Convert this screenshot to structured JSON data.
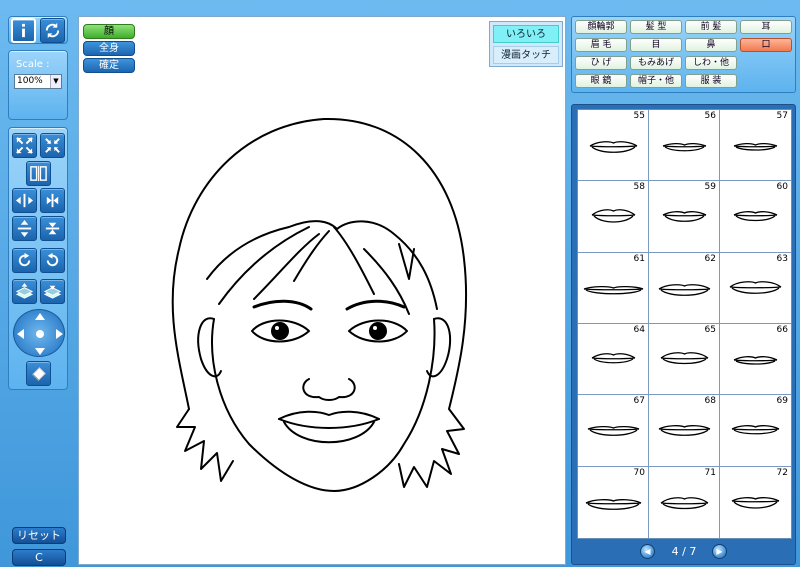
{
  "left_panel": {
    "scale_label": "Scale :",
    "scale_value": "100%",
    "reset_label": "リセット",
    "clear_label": "C"
  },
  "canvas": {
    "mode_buttons": [
      "顔",
      "全身",
      "確定"
    ],
    "active_mode": "顔",
    "style_buttons": [
      "いろいろ",
      "漫画タッチ"
    ],
    "active_style": "いろいろ"
  },
  "categories": {
    "items": [
      "顔輪郭",
      "髪 型",
      "前 髪",
      "耳",
      "眉 毛",
      "目",
      "鼻",
      "口",
      "ひ げ",
      "もみあげ",
      "しわ・他",
      "眼 鏡",
      "帽子・他",
      "服 装"
    ],
    "active": "口"
  },
  "parts": {
    "cells": [
      {
        "num": "55"
      },
      {
        "num": "56"
      },
      {
        "num": "57"
      },
      {
        "num": "58"
      },
      {
        "num": "59"
      },
      {
        "num": "60"
      },
      {
        "num": "61"
      },
      {
        "num": "62"
      },
      {
        "num": "63"
      },
      {
        "num": "64"
      },
      {
        "num": "65"
      },
      {
        "num": "66"
      },
      {
        "num": "67"
      },
      {
        "num": "68"
      },
      {
        "num": "69"
      },
      {
        "num": "70"
      },
      {
        "num": "71"
      },
      {
        "num": "72"
      }
    ],
    "page_indicator": "4 / 7"
  },
  "colors": {
    "active_mode": "#5cc44a",
    "active_category": "#f58a5f",
    "active_style": "#7ff0f6"
  }
}
